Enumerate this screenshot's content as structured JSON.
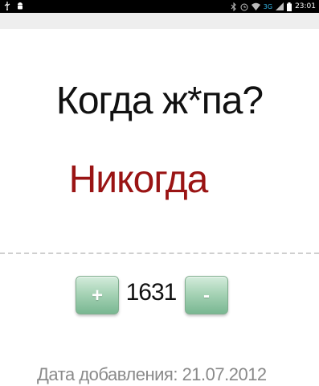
{
  "status_bar": {
    "network": "3G",
    "time": "23:01",
    "icons": [
      "usb-icon",
      "android-icon",
      "bluetooth-icon",
      "alarm-icon",
      "wifi-icon",
      "signal-icon",
      "battery-icon"
    ]
  },
  "post": {
    "question": "Когда ж*па?",
    "answer": "Никогда",
    "score": "1631",
    "plus_label": "+",
    "minus_label": "-",
    "date_text": "Дата добавления: 21.07.2012"
  },
  "colors": {
    "answer": "#9a1414",
    "button_green": "#79b792",
    "status_bar": "#000000"
  }
}
